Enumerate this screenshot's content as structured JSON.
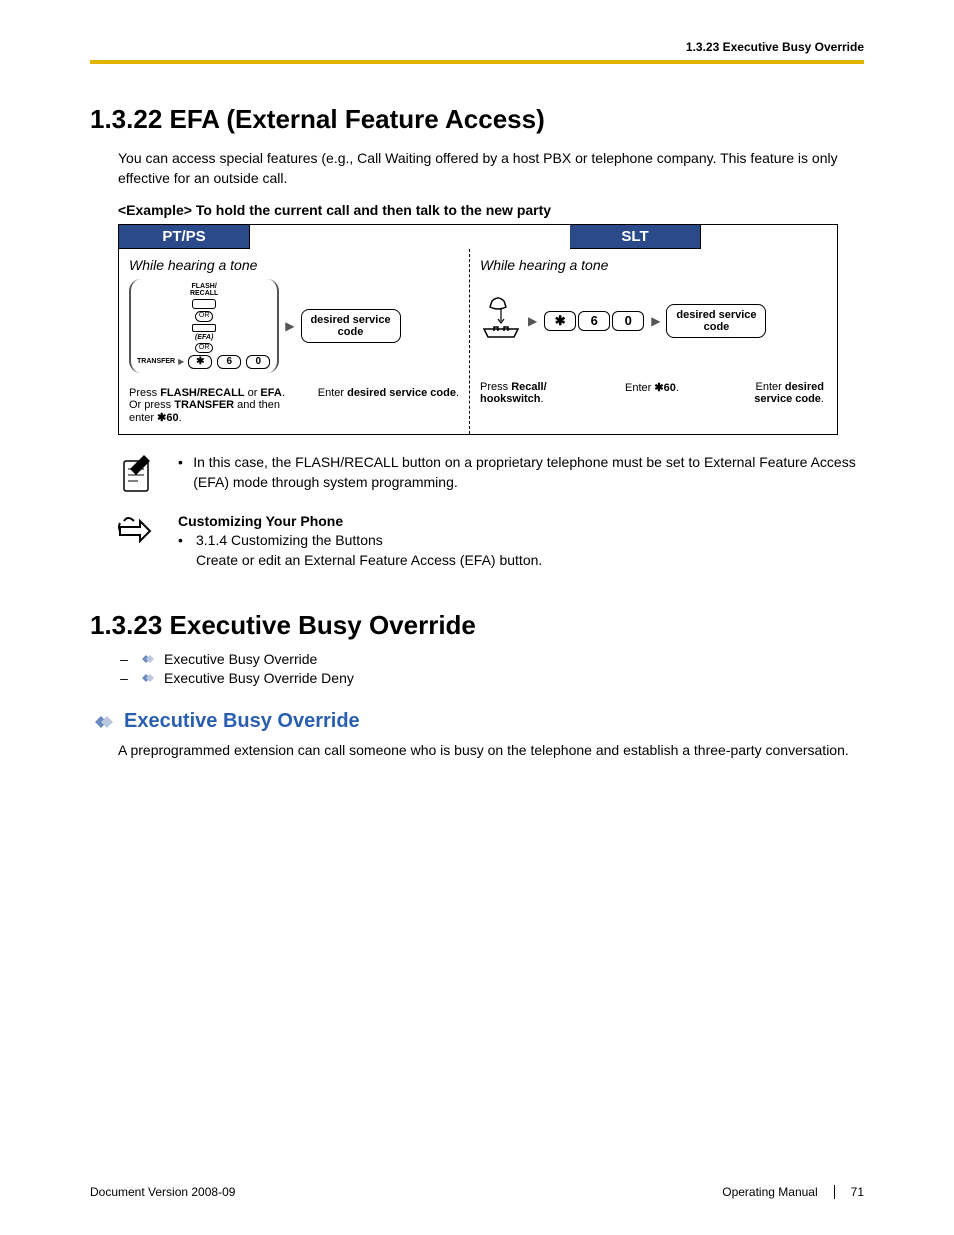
{
  "header": {
    "section_label": "1.3.23 Executive Busy Override"
  },
  "sec1": {
    "title": "1.3.22  EFA (External Feature Access)",
    "intro": "You can access special features (e.g., Call Waiting offered by a host PBX or telephone company. This feature is only effective for an outside call.",
    "example_label": "<Example> To hold the current call and then talk to the new party",
    "diagram": {
      "pt_header": "PT/PS",
      "slt_header": "SLT",
      "tone_text": "While hearing a tone",
      "flash_recall": "FLASH/\nRECALL",
      "or": "OR",
      "efa": "(EFA)",
      "transfer": "TRANSFER",
      "star": "✱",
      "k6": "6",
      "k0": "0",
      "desired": "desired service code",
      "cap_pt_a": "Press FLASH/RECALL or EFA. Or press TRANSFER and then enter ✱60.",
      "cap_pt_b": "Enter desired service code.",
      "cap_slt_a": "Press Recall/ hookswitch.",
      "cap_slt_b": "Enter ✱60.",
      "cap_slt_c": "Enter desired service code."
    },
    "note1": "In this case, the FLASH/RECALL button on a proprietary telephone must be set to External Feature Access (EFA) mode through system programming.",
    "custom_heading": "Customizing Your Phone",
    "custom_line1": "3.1.4  Customizing the Buttons",
    "custom_line2": "Create or edit an External Feature Access (EFA) button."
  },
  "sec2": {
    "title": "1.3.23  Executive Busy Override",
    "link1": "Executive Busy Override",
    "link2": "Executive Busy Override Deny",
    "sub_heading": "Executive Busy Override",
    "sub_body": "A preprogrammed extension can call someone who is busy on the telephone and establish a three-party conversation."
  },
  "footer": {
    "left": "Document Version  2008-09",
    "manual": "Operating Manual",
    "page": "71"
  }
}
